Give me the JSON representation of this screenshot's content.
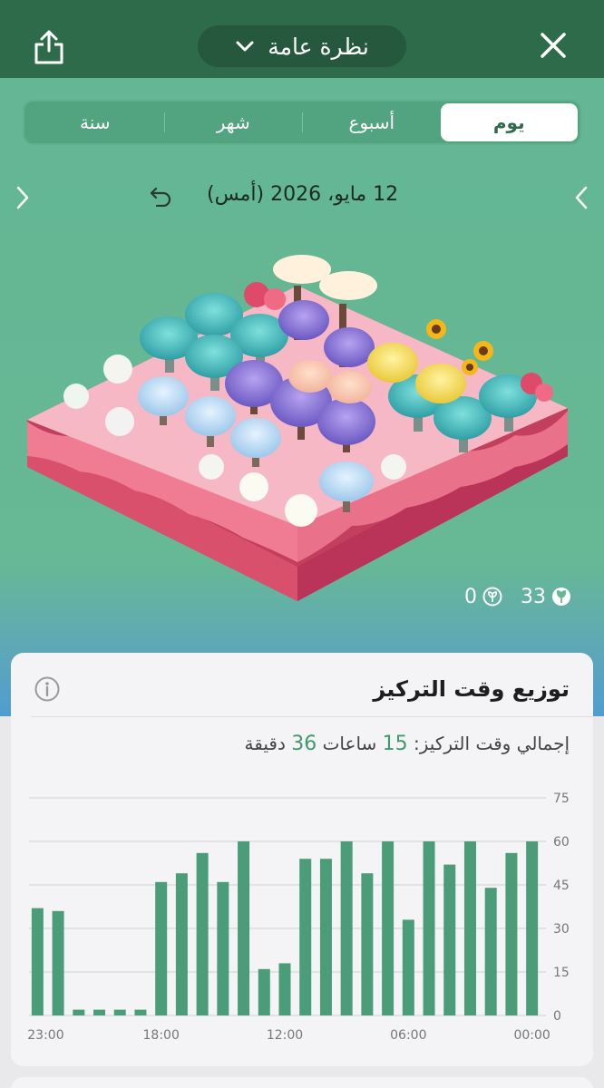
{
  "header": {
    "title": "نظرة عامة",
    "share_icon": "share-icon",
    "close_icon": "close-icon",
    "dropdown_icon": "chevron-down-icon"
  },
  "tabs": [
    {
      "label": "يوم",
      "active": true
    },
    {
      "label": "أسبوع",
      "active": false
    },
    {
      "label": "شهر",
      "active": false
    },
    {
      "label": "سنة",
      "active": false
    }
  ],
  "date_nav": {
    "date_label": "12 مايو، 2026  (أمس)",
    "prev_icon": "chevron-right-icon",
    "next_icon": "chevron-left-icon",
    "reset_icon": "undo-icon"
  },
  "counts": {
    "healthy_trees": "33",
    "dead_trees": "0"
  },
  "focus_card": {
    "title": "توزيع وقت التركيز",
    "summary_prefix": "إجمالي وقت التركيز:",
    "hours": "15",
    "hours_unit": "ساعات",
    "minutes": "36",
    "minutes_unit": "دقيقة"
  },
  "colors": {
    "accent": "#3f9a6e",
    "header": "#2e6b4a",
    "background": "#67b895",
    "bar": "#4a9d78"
  },
  "chart_data": {
    "type": "bar",
    "x": [
      "00:00",
      "01:00",
      "02:00",
      "03:00",
      "04:00",
      "05:00",
      "06:00",
      "07:00",
      "08:00",
      "09:00",
      "10:00",
      "11:00",
      "12:00",
      "13:00",
      "14:00",
      "15:00",
      "16:00",
      "17:00",
      "18:00",
      "19:00",
      "20:00",
      "21:00",
      "22:00",
      "23:00"
    ],
    "values": [
      60,
      56,
      44,
      60,
      52,
      60,
      33,
      60,
      49,
      60,
      54,
      54,
      18,
      16,
      60,
      46,
      56,
      49,
      46,
      2,
      2,
      2,
      2,
      36,
      37
    ],
    "xtick_labels": [
      "00:00",
      "06:00",
      "12:00",
      "18:00",
      "23:00"
    ],
    "yticks": [
      "0",
      "15",
      "30",
      "45",
      "60",
      "75"
    ],
    "ylim": [
      0,
      75
    ],
    "x_direction": "right-to-left",
    "grid": true
  }
}
